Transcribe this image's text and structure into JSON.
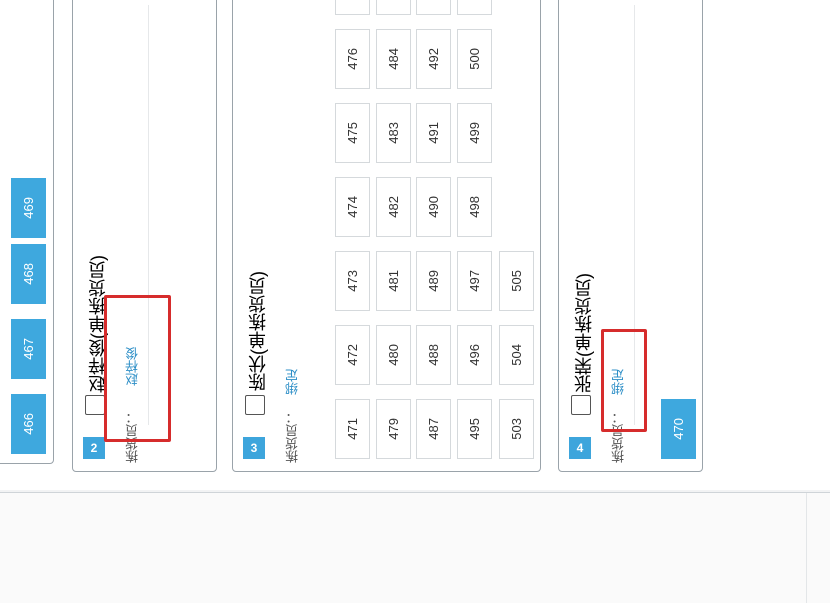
{
  "card1": {
    "blue_slots": [
      "466",
      "467",
      "468",
      "469"
    ]
  },
  "card2": {
    "number": "2",
    "picker_name": "赵梓俊(单拣货员)",
    "picker_label": "拣货员：",
    "picker_value": "赵梓俊"
  },
  "card3": {
    "number": "3",
    "picker_name": "陈伏(单拣货员)",
    "picker_label": "拣货员：",
    "bind_label": "绑定",
    "slots": [
      [
        "471",
        "472",
        "473",
        "474",
        "475",
        "476"
      ],
      [
        "479",
        "480",
        "481",
        "482",
        "483",
        "484"
      ],
      [
        "487",
        "488",
        "489",
        "490",
        "491",
        "492"
      ],
      [
        "495",
        "496",
        "497",
        "498",
        "499",
        "500"
      ],
      [
        "503",
        "504",
        "505"
      ]
    ]
  },
  "card4": {
    "number": "4",
    "picker_name": "张荣(单拣货员)",
    "picker_label": "拣货员：",
    "bind_label": "绑定",
    "blue_slot": "470"
  },
  "colors": {
    "accent_blue": "#3da5dc",
    "highlight_red": "#d62c2c",
    "link": "#2e8fc7"
  }
}
